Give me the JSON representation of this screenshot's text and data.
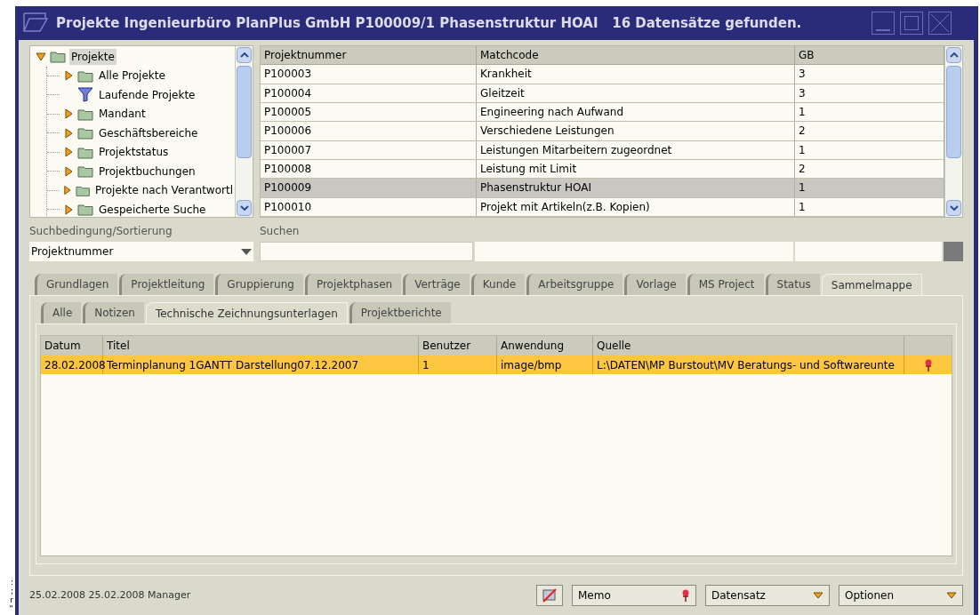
{
  "edge_marks": [
    ":",
    ";",
    "r",
    "“"
  ],
  "window": {
    "title": "Projekte Ingenieurbüro PlanPlus GmbH P100009/1 Phasenstruktur HOAI   16 Datensätze gefunden."
  },
  "tree": {
    "label": "Projekte",
    "kind": "folder",
    "expanded": true,
    "selected": true,
    "children": [
      {
        "label": "Alle Projekte",
        "kind": "folder",
        "expanded": false,
        "selected": false
      },
      {
        "label": "Laufende Projekte",
        "kind": "filter",
        "selected": false
      },
      {
        "label": "Mandant",
        "kind": "folder",
        "expanded": false,
        "selected": false
      },
      {
        "label": "Geschäftsbereiche",
        "kind": "folder",
        "expanded": false,
        "selected": false
      },
      {
        "label": "Projektstatus",
        "kind": "folder",
        "expanded": false,
        "selected": false
      },
      {
        "label": "Projektbuchungen",
        "kind": "folder",
        "expanded": false,
        "selected": false
      },
      {
        "label": "Projekte nach Verantwortl",
        "kind": "folder",
        "expanded": false,
        "selected": false
      },
      {
        "label": "Gespeicherte Suche",
        "kind": "folder",
        "expanded": false,
        "selected": false
      }
    ]
  },
  "table": {
    "columns": [
      "Projektnummer",
      "Matchcode",
      "GB"
    ],
    "rows": [
      {
        "cells": [
          "P100003",
          "Krankheit",
          "3"
        ],
        "selected": false
      },
      {
        "cells": [
          "P100004",
          "Gleitzeit",
          "3"
        ],
        "selected": false
      },
      {
        "cells": [
          "P100005",
          "Engineering nach Aufwand",
          "1"
        ],
        "selected": false
      },
      {
        "cells": [
          "P100006",
          "Verschiedene Leistungen",
          "2"
        ],
        "selected": false
      },
      {
        "cells": [
          "P100007",
          "Leistungen Mitarbeitern zugeordnet",
          "1"
        ],
        "selected": false
      },
      {
        "cells": [
          "P100008",
          "Leistung mit Limit",
          "2"
        ],
        "selected": false
      },
      {
        "cells": [
          "P100009",
          "Phasenstruktur HOAI",
          "1"
        ],
        "selected": true
      },
      {
        "cells": [
          "P100010",
          "Projekt mit Artikeln(z.B. Kopien)",
          "1"
        ],
        "selected": false
      }
    ]
  },
  "search": {
    "sort_label": "Suchbedingung/Sortierung",
    "sort_value": "Projektnummer",
    "search_label": "Suchen"
  },
  "tabs": [
    {
      "label": "Grundlagen",
      "selected": false
    },
    {
      "label": "Projektleitung",
      "selected": false
    },
    {
      "label": "Gruppierung",
      "selected": false
    },
    {
      "label": "Projektphasen",
      "selected": false
    },
    {
      "label": "Verträge",
      "selected": false
    },
    {
      "label": "Kunde",
      "selected": false
    },
    {
      "label": "Arbeitsgruppe",
      "selected": false
    },
    {
      "label": "Vorlage",
      "selected": false
    },
    {
      "label": "MS Project",
      "selected": false
    },
    {
      "label": "Status",
      "selected": false
    },
    {
      "label": "Sammelmappe",
      "selected": true
    }
  ],
  "subtabs": [
    {
      "label": "Alle",
      "selected": false
    },
    {
      "label": "Notizen",
      "selected": false
    },
    {
      "label": "Technische Zeichnungsunterlagen",
      "selected": true
    },
    {
      "label": "Projektberichte",
      "selected": false
    }
  ],
  "documents": {
    "columns": [
      "Datum",
      "Titel",
      "Benutzer",
      "Anwendung",
      "Quelle"
    ],
    "rows": [
      {
        "cells": [
          "28.02.2008",
          "Terminplanung 1GANTT Darstellung07.12.2007",
          "1",
          "image/bmp",
          "L:\\DATEN\\MP Burstout\\MV Beratungs- und Softwareunte"
        ],
        "selected": true,
        "pinned": true
      }
    ]
  },
  "status_bar": {
    "text": "25.02.2008 25.02.2008 Manager"
  },
  "buttons": [
    {
      "kind": "icon"
    },
    {
      "kind": "pin",
      "label": "Memo"
    },
    {
      "kind": "dropdown",
      "label": "Datensatz"
    },
    {
      "kind": "dropdown",
      "label": "Optionen"
    }
  ]
}
